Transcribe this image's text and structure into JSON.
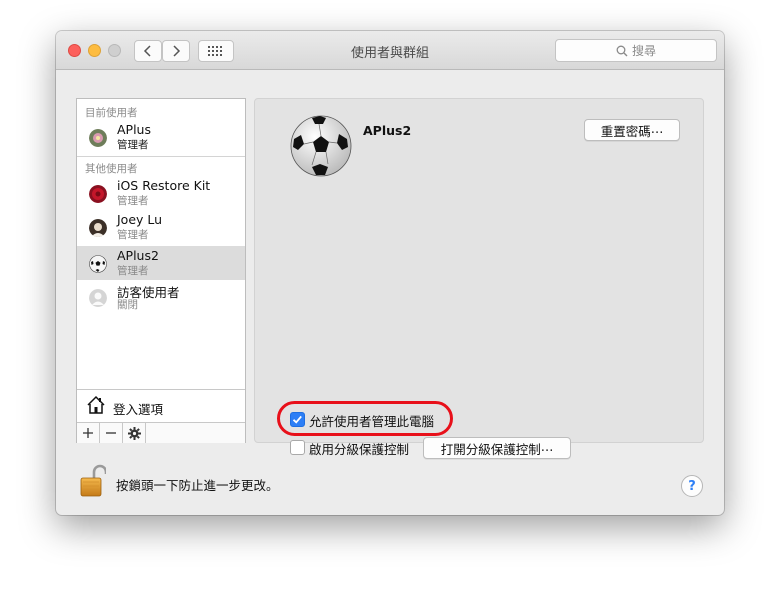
{
  "window": {
    "title": "使用者與群組",
    "search_placeholder": "搜尋"
  },
  "sidebar": {
    "current_header": "目前使用者",
    "others_header": "其他使用者",
    "current_user": {
      "name": "APlus",
      "role": "管理者",
      "avatar": "flower-avatar"
    },
    "other_users": [
      {
        "name": "iOS Restore Kit",
        "role": "管理者",
        "avatar": "red-flower-avatar"
      },
      {
        "name": "Joey Lu",
        "role": "管理者",
        "avatar": "portrait-avatar"
      },
      {
        "name": "APlus2",
        "role": "管理者",
        "avatar": "soccer-ball-avatar",
        "selected": true
      },
      {
        "name": "訪客使用者",
        "role": "關閉",
        "avatar": "guest-avatar"
      }
    ],
    "login_options": "登入選項"
  },
  "detail": {
    "user_name": "APlus2",
    "reset_password_button": "重置密碼⋯",
    "allow_admin_label": "允許使用者管理此電腦",
    "allow_admin_checked": true,
    "parental_controls_label": "啟用分級保護控制",
    "parental_controls_checked": false,
    "open_parental_button": "打開分級保護控制⋯"
  },
  "footer": {
    "lock_text": "按鎖頭一下防止進一步更改。",
    "help_label": "?"
  },
  "colors": {
    "accent": "#2d7ff6",
    "highlight_ring": "#e8101a"
  }
}
